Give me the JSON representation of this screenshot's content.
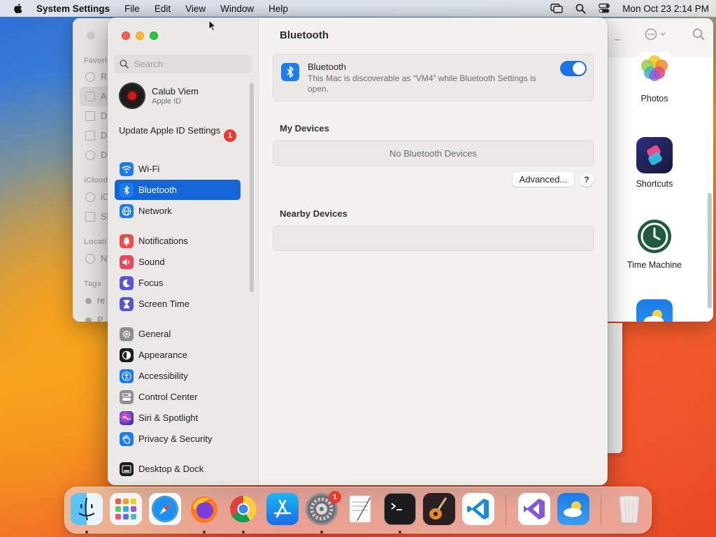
{
  "menubar": {
    "app_name": "System Settings",
    "menus": [
      "File",
      "Edit",
      "View",
      "Window",
      "Help"
    ],
    "clock": "Mon Oct 23  2:14 PM",
    "status_icons": [
      "screen-mirroring-icon",
      "spotlight-search-icon",
      "control-center-icon"
    ]
  },
  "finder": {
    "sidebar": {
      "favorites_header": "Favori",
      "icloud_header": "iCloud",
      "locations_header": "Locati",
      "tags_header": "Tags",
      "rows": [
        "R",
        "A",
        "D",
        "D",
        "D",
        "iC",
        "Sl",
        "N",
        "re",
        "P"
      ]
    },
    "apps": [
      {
        "name": "Photos",
        "icon": "photos-icon"
      },
      {
        "name": "Shortcuts",
        "icon": "shortcuts-icon"
      },
      {
        "name": "Time Machine",
        "icon": "time-machine-icon"
      },
      {
        "name": "",
        "icon": "weather-icon"
      }
    ]
  },
  "settings": {
    "search_placeholder": "Search",
    "account": {
      "name": "Calub Viem",
      "subtitle": "Apple ID"
    },
    "update_notice": "Update Apple ID Settings",
    "update_badge": "1",
    "nav": [
      {
        "label": "Wi-Fi",
        "icon": "wifi-icon",
        "color": "#1b7cf2"
      },
      {
        "label": "Bluetooth",
        "icon": "bluetooth-icon",
        "color": "#1b7cf2",
        "active": true
      },
      {
        "label": "Network",
        "icon": "network-globe-icon",
        "color": "#1b7cf2"
      },
      {
        "label": "Notifications",
        "icon": "notifications-bell-icon",
        "color": "#f04a45"
      },
      {
        "label": "Sound",
        "icon": "speaker-icon",
        "color": "#f0435c"
      },
      {
        "label": "Focus",
        "icon": "moon-icon",
        "color": "#5b54d6"
      },
      {
        "label": "Screen Time",
        "icon": "hourglass-icon",
        "color": "#5b54d6"
      },
      {
        "label": "General",
        "icon": "gear-icon",
        "color": "#8e8e93"
      },
      {
        "label": "Appearance",
        "icon": "appearance-icon",
        "color": "#1c1c1e"
      },
      {
        "label": "Accessibility",
        "icon": "accessibility-icon",
        "color": "#1b7cf2"
      },
      {
        "label": "Control Center",
        "icon": "control-center-icon",
        "color": "#8e8e93"
      },
      {
        "label": "Siri & Spotlight",
        "icon": "siri-icon",
        "color": "#8a3fd1"
      },
      {
        "label": "Privacy & Security",
        "icon": "hand-icon",
        "color": "#1b7cf2"
      },
      {
        "label": "Desktop & Dock",
        "icon": "dock-icon",
        "color": "#1c1c1e"
      }
    ],
    "pane": {
      "title": "Bluetooth",
      "bluetooth_label": "Bluetooth",
      "bluetooth_desc": "This Mac is discoverable as “VM4” while Bluetooth Settings is open.",
      "bluetooth_on": true,
      "my_devices_header": "My Devices",
      "no_devices": "No Bluetooth Devices",
      "advanced_button": "Advanced...",
      "help_button": "?",
      "nearby_header": "Nearby Devices"
    }
  },
  "dock": {
    "apps": [
      {
        "name": "Finder",
        "icon": "finder-icon",
        "running": true
      },
      {
        "name": "Launchpad",
        "icon": "launchpad-icon",
        "running": false
      },
      {
        "name": "Safari",
        "icon": "safari-icon",
        "running": false
      },
      {
        "name": "Firefox",
        "icon": "firefox-icon",
        "running": true
      },
      {
        "name": "Chrome",
        "icon": "chrome-icon",
        "running": true
      },
      {
        "name": "App Store",
        "icon": "app-store-icon",
        "running": false
      },
      {
        "name": "System Settings",
        "icon": "system-settings-icon",
        "running": true,
        "badge": "1"
      },
      {
        "name": "TextEdit",
        "icon": "textedit-icon",
        "running": false
      },
      {
        "name": "Terminal",
        "icon": "terminal-icon",
        "running": true
      },
      {
        "name": "GarageBand",
        "icon": "garageband-icon",
        "running": false
      },
      {
        "name": "Visual Studio Code",
        "icon": "vscode-icon",
        "running": false
      },
      {
        "name": "Visual Studio",
        "icon": "visual-studio-icon",
        "running": false
      },
      {
        "name": "Weather",
        "icon": "weather-icon",
        "running": false
      },
      {
        "name": "Trash",
        "icon": "trash-icon",
        "running": false
      }
    ]
  }
}
